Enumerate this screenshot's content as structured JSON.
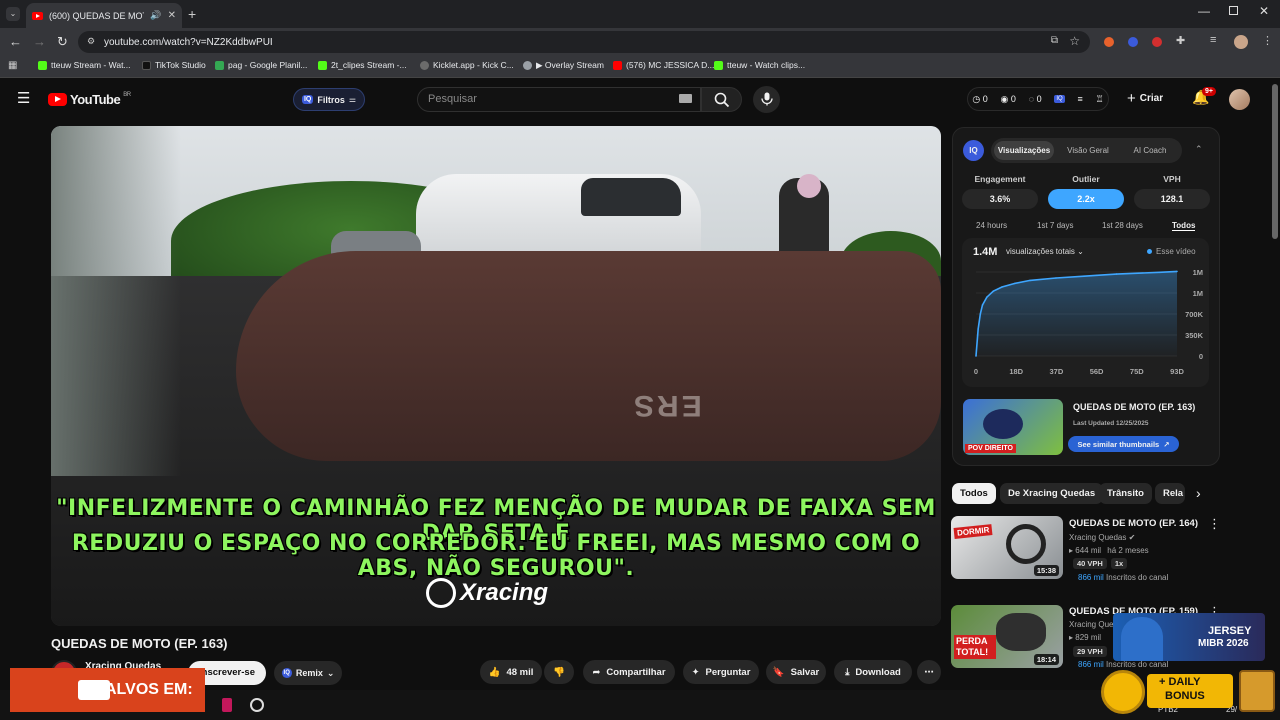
{
  "browser": {
    "tab_title": "(600) QUEDAS DE MOTO (E...",
    "url": "youtube.com/watch?v=NZ2KddbwPUI",
    "bookmarks": [
      {
        "label": "tteuw Stream - Wat...",
        "color": "#53fc18"
      },
      {
        "label": "TikTok Studio",
        "color": "#111111"
      },
      {
        "label": "pag - Google Planil...",
        "color": "#34a853"
      },
      {
        "label": "2t_clipes Stream -...",
        "color": "#53fc18"
      },
      {
        "label": "Kicklet.app - Kick C...",
        "color": "#6b6b6b"
      },
      {
        "label": "▶ Overlay Stream",
        "color": "#9aa0a6"
      },
      {
        "label": "(576) MC JESSICA D...",
        "color": "#ff0000"
      },
      {
        "label": "tteuw - Watch clips...",
        "color": "#53fc18"
      }
    ]
  },
  "header": {
    "logo": "YouTube",
    "country": "BR",
    "filters_label": "Filtros",
    "search_placeholder": "Pesquisar",
    "counters": [
      "0",
      "0",
      "0"
    ],
    "create_label": "Criar",
    "notif_badge": "9+"
  },
  "video": {
    "subtitle_line1": "\"INFELIZMENTE O CAMINHÃO FEZ MENÇÃO DE MUDAR DE FAIXA SEM DAR SETA E",
    "subtitle_line2": "REDUZIU O ESPAÇO NO CORREDOR. EU FREEI, MAS MESMO COM O ABS, NÃO SEGUROU\".",
    "watermark": "Xracing",
    "glove_text": "ERS",
    "title": "QUEDAS DE MOTO (EP. 163)",
    "channel": "Xracing Quedas",
    "subscribe_label": "Inscrever-se",
    "remix_label": "Remix",
    "likes": "48 mil",
    "share_label": "Compartilhar",
    "ask_label": "Perguntar",
    "save_label": "Salvar",
    "download_label": "Download"
  },
  "iq_panel": {
    "logo": "IQ",
    "tabs": [
      "Visualizações",
      "Visão Geral",
      "AI Coach"
    ],
    "stats": [
      {
        "label": "Engagement",
        "value": "3.6%"
      },
      {
        "label": "Outlier",
        "value": "2.2x"
      },
      {
        "label": "VPH",
        "value": "128.1"
      }
    ],
    "ranges": [
      "24 hours",
      "1st 7 days",
      "1st 28 days",
      "Todos"
    ],
    "total_views": "1.4M",
    "metric_select": "visualizações totais",
    "legend": "Esse vídeo",
    "series_color": "#3ea6ff",
    "similar": {
      "title": "QUEDAS DE MOTO (EP. 163)",
      "updated": "Last Updated 12/25/2025",
      "button": "See similar thumbnails",
      "thumb_text": "POV DIREITO"
    }
  },
  "chart_data": {
    "type": "area",
    "x_ticks": [
      "0",
      "18D",
      "37D",
      "56D",
      "75D",
      "93D"
    ],
    "y_ticks": [
      "0",
      "350K",
      "700K",
      "1M",
      "1M"
    ],
    "x": [
      0,
      1,
      2,
      3,
      5,
      8,
      12,
      18,
      25,
      37,
      50,
      56,
      65,
      75,
      85,
      93
    ],
    "values": [
      0,
      450000,
      700000,
      850000,
      980000,
      1080000,
      1150000,
      1210000,
      1260000,
      1300000,
      1330000,
      1345000,
      1365000,
      1380000,
      1395000,
      1410000
    ],
    "xlim": [
      0,
      93
    ],
    "ylim": [
      0,
      1400000
    ]
  },
  "chips": [
    "Todos",
    "De Xracing Quedas",
    "Trânsito",
    "Rela"
  ],
  "recommendations": [
    {
      "title": "QUEDAS DE MOTO (EP. 164)",
      "channel": "Xracing Quedas",
      "views": "644 mil",
      "age": "há 2 meses",
      "vph": "40 VPH",
      "mult": "1x",
      "subs": "866 mil",
      "subs_label": "Inscritos do canal",
      "duration": "15:38",
      "thumb_text": "DORMIR"
    },
    {
      "title": "QUEDAS DE MOTO (EP. 159)",
      "channel": "Xracing Quedas",
      "views": "829 mil",
      "age": "",
      "vph": "29 VPH",
      "mult": "",
      "subs": "866 mil",
      "subs_label": "Inscritos do canal",
      "duration": "18:14",
      "thumb_text": "PERDA TOTAL!"
    }
  ],
  "overlays": {
    "alvos": "ALVOS EM:",
    "jersey_line1": "JERSEY",
    "jersey_line2": "MIBR 2026",
    "daily_bonus_line1": "+ DAILY",
    "daily_bonus_line2": "BONUS",
    "tray_lang": "PTB2",
    "tray_date": "29/"
  }
}
